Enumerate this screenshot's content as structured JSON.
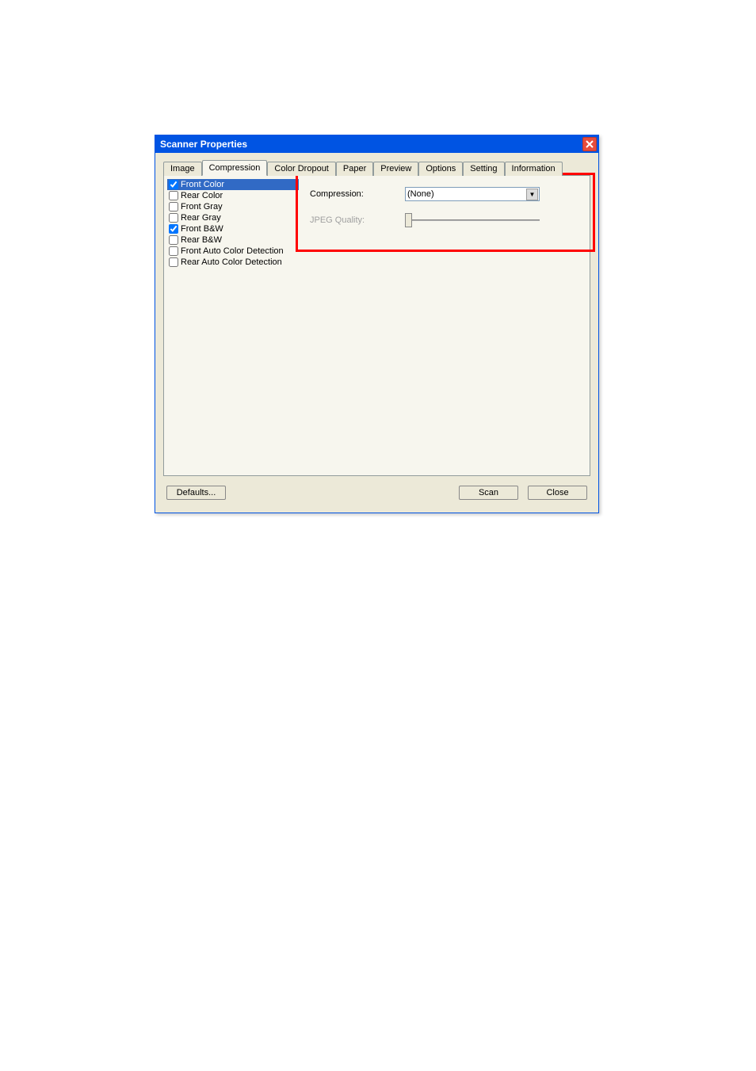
{
  "window": {
    "title": "Scanner Properties"
  },
  "tabs": {
    "t0": "Image",
    "t1": "Compression",
    "t2": "Color Dropout",
    "t3": "Paper",
    "t4": "Preview",
    "t5": "Options",
    "t6": "Setting",
    "t7": "Information"
  },
  "sidelist": {
    "i0": "Front Color",
    "i1": "Rear Color",
    "i2": "Front Gray",
    "i3": "Rear Gray",
    "i4": "Front B&W",
    "i5": "Rear B&W",
    "i6": "Front Auto Color Detection",
    "i7": "Rear Auto Color Detection"
  },
  "form": {
    "compression_label": "Compression:",
    "compression_value": "(None)",
    "jpeg_label": "JPEG Quality:"
  },
  "buttons": {
    "defaults": "Defaults...",
    "scan": "Scan",
    "close": "Close"
  }
}
